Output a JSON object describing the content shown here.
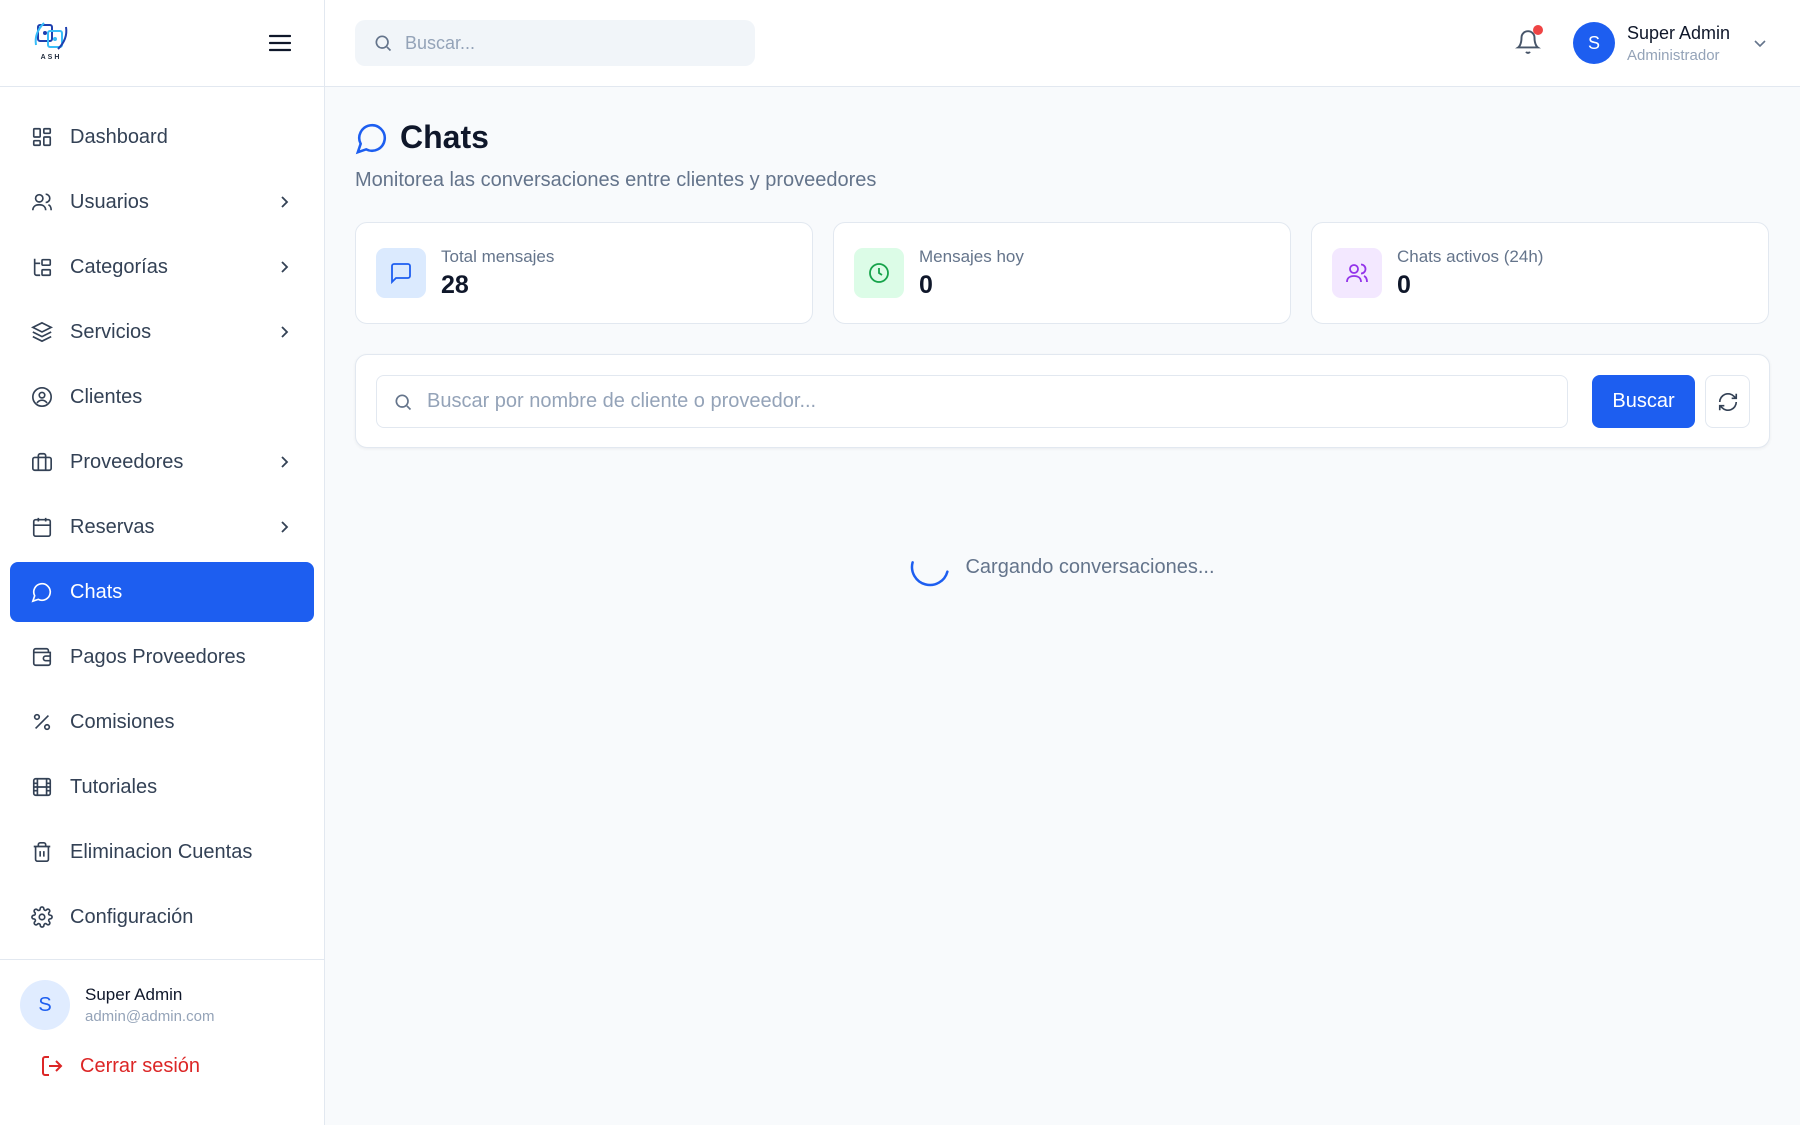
{
  "brand": {
    "logo_text": "ASH"
  },
  "sidebar": {
    "items": [
      {
        "label": "Dashboard",
        "icon": "grid-icon"
      },
      {
        "label": "Usuarios",
        "icon": "users-icon",
        "has_submenu": true
      },
      {
        "label": "Categorías",
        "icon": "hierarchy-icon",
        "has_submenu": true
      },
      {
        "label": "Servicios",
        "icon": "layers-icon",
        "has_submenu": true
      },
      {
        "label": "Clientes",
        "icon": "user-circle-icon"
      },
      {
        "label": "Proveedores",
        "icon": "briefcase-icon",
        "has_submenu": true
      },
      {
        "label": "Reservas",
        "icon": "calendar-icon",
        "has_submenu": true
      },
      {
        "label": "Chats",
        "icon": "message-circle-icon",
        "active": true
      },
      {
        "label": "Pagos Proveedores",
        "icon": "wallet-icon"
      },
      {
        "label": "Comisiones",
        "icon": "percent-icon"
      },
      {
        "label": "Tutoriales",
        "icon": "film-icon"
      },
      {
        "label": "Eliminacion Cuentas",
        "icon": "trash-icon"
      },
      {
        "label": "Configuración",
        "icon": "gear-icon"
      }
    ],
    "user": {
      "initial": "S",
      "name": "Super Admin",
      "email": "admin@admin.com"
    },
    "logout_label": "Cerrar sesión"
  },
  "topbar": {
    "search_placeholder": "Buscar...",
    "has_notification": true,
    "user": {
      "initial": "S",
      "name": "Super Admin",
      "role": "Administrador"
    }
  },
  "page": {
    "title": "Chats",
    "subtitle": "Monitorea las conversaciones entre clientes y proveedores",
    "stats": [
      {
        "label": "Total mensajes",
        "value": "28",
        "icon": "message-square-icon",
        "color": "#1d5ef0",
        "bg": "#dbeafe"
      },
      {
        "label": "Mensajes hoy",
        "value": "0",
        "icon": "clock-icon",
        "color": "#16a34a",
        "bg": "#dcfce7"
      },
      {
        "label": "Chats activos (24h)",
        "value": "0",
        "icon": "users-icon",
        "color": "#9333ea",
        "bg": "#f3e8ff"
      }
    ],
    "search_placeholder": "Buscar por nombre de cliente o proveedor...",
    "search_button": "Buscar",
    "loading_text": "Cargando conversaciones..."
  },
  "colors": {
    "accent": "#1d5ef0",
    "danger": "#dc2626",
    "notification": "#ef4444"
  }
}
